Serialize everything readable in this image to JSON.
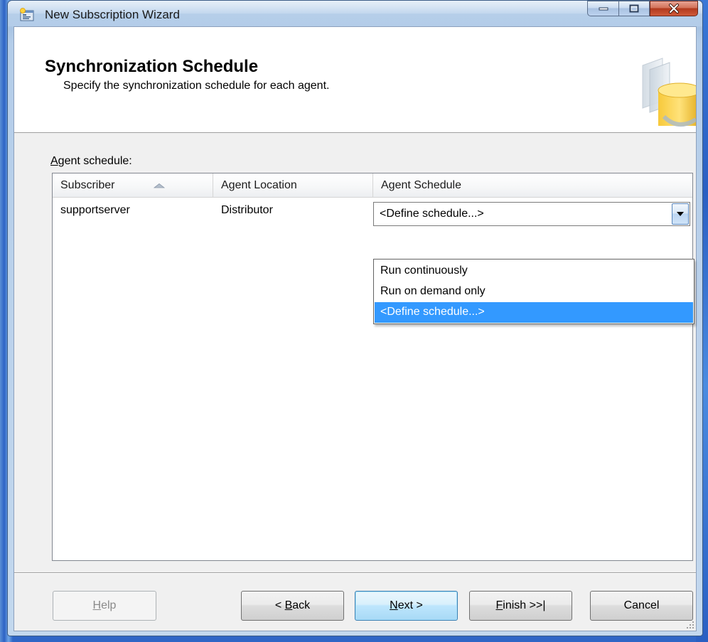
{
  "window": {
    "title": "New Subscription Wizard"
  },
  "header": {
    "title": "Synchronization Schedule",
    "subtitle": "Specify the synchronization schedule for each agent."
  },
  "grid": {
    "label_first": "A",
    "label_rest": "gent schedule:",
    "columns": [
      "Subscriber",
      "Agent Location",
      "Agent Schedule"
    ],
    "sort_column": "Subscriber",
    "rows": [
      {
        "subscriber": "supportserver",
        "agent_location": "Distributor",
        "agent_schedule": "<Define schedule...>"
      }
    ]
  },
  "schedule_dropdown": {
    "selected": "<Define schedule...>",
    "options": [
      "Run continuously",
      "Run on demand only",
      "<Define schedule...>"
    ]
  },
  "buttons": {
    "help": {
      "first": "H",
      "rest": "elp"
    },
    "back": {
      "pre": "< ",
      "first": "B",
      "rest": "ack"
    },
    "next": {
      "first": "N",
      "rest": "ext >"
    },
    "finish": {
      "first": "F",
      "rest": "inish >>|"
    },
    "cancel": "Cancel"
  },
  "colors": {
    "selection": "#3399ff",
    "default_button_border": "#3c7fb1",
    "close_button": "#c8452b"
  },
  "icons": [
    "wizard-app-icon",
    "minimize-icon",
    "maximize-icon",
    "close-icon",
    "sort-ascending-icon",
    "dropdown-arrow-icon",
    "wizard-database-graphic",
    "size-grip-icon"
  ]
}
